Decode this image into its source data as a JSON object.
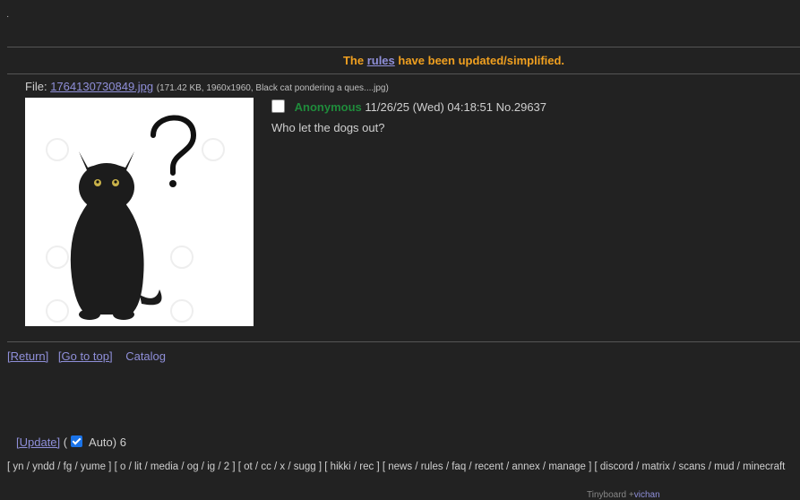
{
  "announcement": {
    "prefix": "The",
    "link": "rules",
    "suffix": "have been updated/simplified."
  },
  "post": {
    "file_label": "File:",
    "file_name": "1764130730849.jpg",
    "file_meta": "(171.42 KB, 1960x1960, Black cat pondering a ques....jpg)",
    "name": "Anonymous",
    "datetime": "11/26/25 (Wed) 04:18:51",
    "number": "No.29637",
    "comment": "Who let the dogs out?"
  },
  "nav": {
    "return": "[Return]",
    "top": "[Go to top]",
    "catalog": "Catalog"
  },
  "update": {
    "link": "[Update]",
    "open_paren": "(",
    "auto_label": "Auto)",
    "count": "6"
  },
  "boards": [
    [
      "yn",
      "yndd",
      "fg",
      "yume"
    ],
    [
      "o",
      "lit",
      "media",
      "og",
      "ig",
      "2"
    ],
    [
      "ot",
      "cc",
      "x",
      "sugg"
    ],
    [
      "hikki",
      "rec"
    ],
    [
      "news",
      "rules",
      "faq",
      "recent",
      "annex",
      "manage"
    ],
    [
      "discord",
      "matrix",
      "scans",
      "mud",
      "minecraft"
    ]
  ],
  "footer": {
    "text": "Tinyboard +",
    "link": "vichan"
  }
}
